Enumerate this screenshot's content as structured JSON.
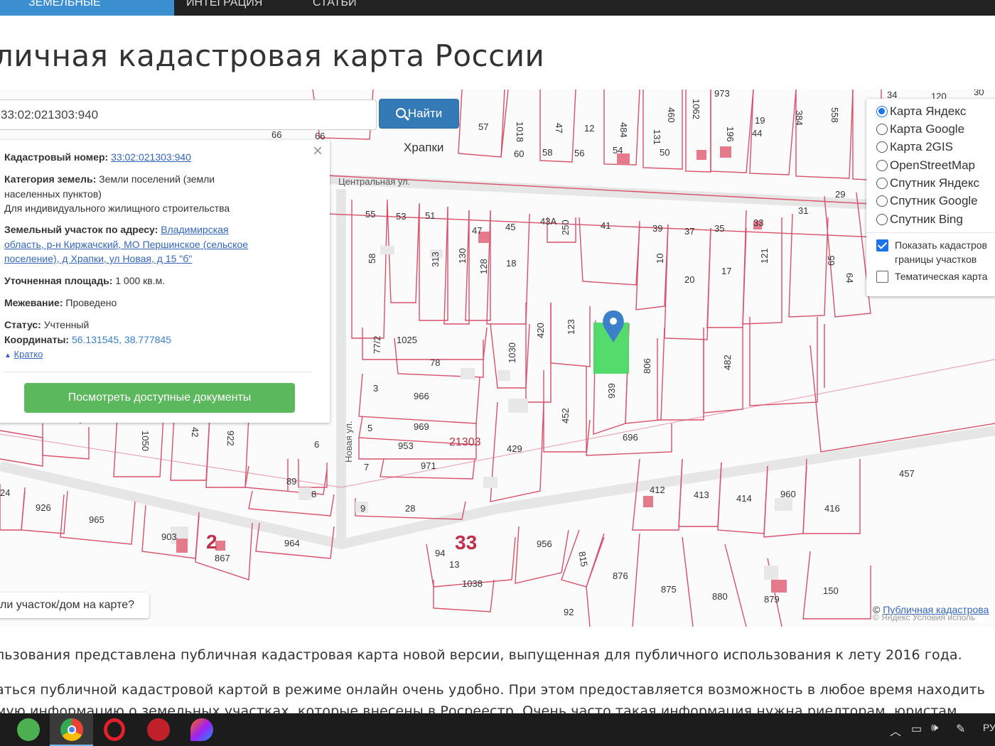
{
  "nav": {
    "active_label": "ЗЕМЕЛЬНЫЕ",
    "items": [
      "ИНТЕГРАЦИЯ",
      "СТАТЬИ"
    ]
  },
  "page": {
    "title": "личная кадастровая карта России"
  },
  "search": {
    "value": "33:02:021303:940",
    "button_label": "Найти"
  },
  "info": {
    "cadastral_label": "Кадастровый номер:",
    "cadastral_value": "33:02:021303:940",
    "category_label": "Категория земель:",
    "category_value_1": "Земли поселений (земли",
    "category_value_2": "населенных пунктов)",
    "usage": "Для индивидуального жилищного строительства",
    "address_label": "Земельный участок по адресу:",
    "address_1": "Владимирская",
    "address_2": "область, р-н Киржачский, МО Першинское (сельское",
    "address_3": "поселение), д Храпки, ул Новая, д 15 \"б\"",
    "area_label": "Уточненная площадь:",
    "area_value": "1 000 кв.м.",
    "survey_label": "Межевание:",
    "survey_value": "Проведено",
    "status_label": "Статус:",
    "status_value": "Учтенный",
    "coords_label": "Координаты:",
    "coords_value": "56.131545, 38.777845",
    "collapse_label": "Кратко",
    "docs_button": "Посмотреть доступные документы",
    "close_symbol": "×"
  },
  "layers": {
    "options": [
      "Карта Яндекс",
      "Карта Google",
      "Карта 2GIS",
      "OpenStreetMap",
      "Спутник Яндекс",
      "Спутник Google",
      "Спутник Bing"
    ],
    "selected": "Карта Яндекс",
    "show_borders_1": "Показать кадастров",
    "show_borders_2": "границы участков",
    "show_borders_checked": true,
    "thematic": "Тематическая карта",
    "thematic_checked": false
  },
  "map": {
    "village": "Храпки",
    "street_central": "Центральная ул.",
    "street_new": "Новая ул.",
    "quarter": "21303",
    "big_number": "33",
    "plot_numbers": [
      "57",
      "1018",
      "47",
      "12",
      "484",
      "131",
      "460",
      "1062",
      "97",
      "973",
      "196",
      "19",
      "44",
      "384",
      "42",
      "558",
      "120",
      "34",
      "30",
      "60",
      "58",
      "56",
      "54",
      "50",
      "66",
      "55",
      "53",
      "51",
      "47",
      "45",
      "43А",
      "41",
      "39",
      "37",
      "35",
      "33",
      "29",
      "31",
      "58",
      "313",
      "130",
      "128",
      "18",
      "250",
      "10",
      "20",
      "17",
      "121",
      "65",
      "64",
      "1025",
      "77/2",
      "78",
      "1030",
      "420",
      "123",
      "806",
      "482",
      "966",
      "3",
      "969",
      "5",
      "953",
      "971",
      "429",
      "452",
      "939",
      "696",
      "457",
      "6",
      "89",
      "8",
      "28",
      "9",
      "412",
      "413",
      "414",
      "960",
      "416",
      "926",
      "965",
      "903",
      "2",
      "867",
      "964",
      "94",
      "13",
      "1038",
      "956",
      "815",
      "876",
      "875",
      "880",
      "879",
      "150",
      "92",
      "24",
      "1050",
      "42",
      "922",
      "7"
    ],
    "not_found_tab": "ли участок/дом на карте?",
    "attribution_link": "Публичная кадастрова",
    "attribution_yandex": "© Яндекс  Условия исполь"
  },
  "body": {
    "line_1": "льзования представлена публичная кадастровая карта новой версии, выпущенная для публичного использования к лету 2016 года.",
    "line_2": "аться публичной кадастровой картой в режиме онлайн очень удобно. При этом предоставляется возможность в любое время находить",
    "line_3": "мую информацию о земельных участках, которые внесены в Росреестр. Очень часто такая информация нужна риелторам, юристам"
  },
  "taskbar": {
    "lang": "РУ"
  },
  "colors": {
    "plot_border": "#d9506a",
    "highlight_plot": "#4cd964",
    "marker": "#3b80c8",
    "search_button": "#337ab7",
    "docs_button": "#5cb85c"
  }
}
